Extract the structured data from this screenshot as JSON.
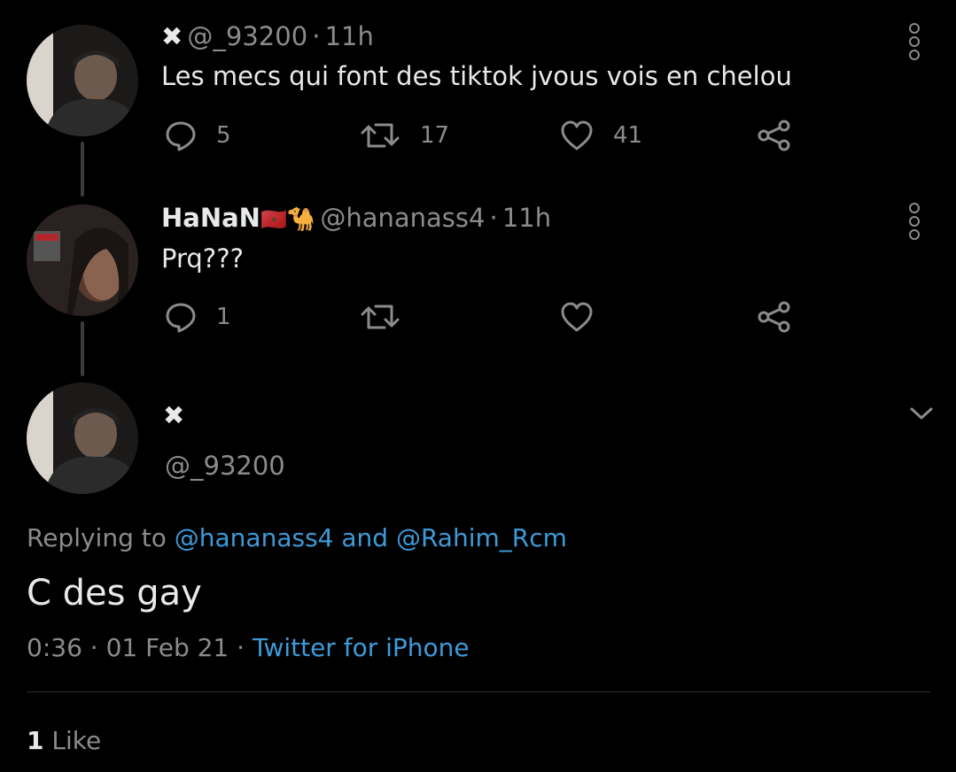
{
  "tweets": [
    {
      "name": "✖",
      "handle": "@_93200",
      "time": "11h",
      "text": "Les mecs qui font des tiktok jvous vois en chelou",
      "replies": "5",
      "retweets": "17",
      "likes": "41"
    },
    {
      "name": "HaNaN",
      "flag": "🇲🇦",
      "emoji": "🐪",
      "handle": "@hananass4",
      "time": "11h",
      "text": "Prq???",
      "replies": "1",
      "retweets": "",
      "likes": ""
    }
  ],
  "main": {
    "name": "✖",
    "handle": "@_93200",
    "replying_prefix": "Replying to",
    "replying_user1": "@hananass4",
    "replying_and": "and",
    "replying_user2": "@Rahim_Rcm",
    "text": "C des gay",
    "time": "0:36",
    "date": "01 Feb 21",
    "source": "Twitter for iPhone",
    "like_count": "1",
    "like_label": "Like"
  },
  "separator": "·"
}
